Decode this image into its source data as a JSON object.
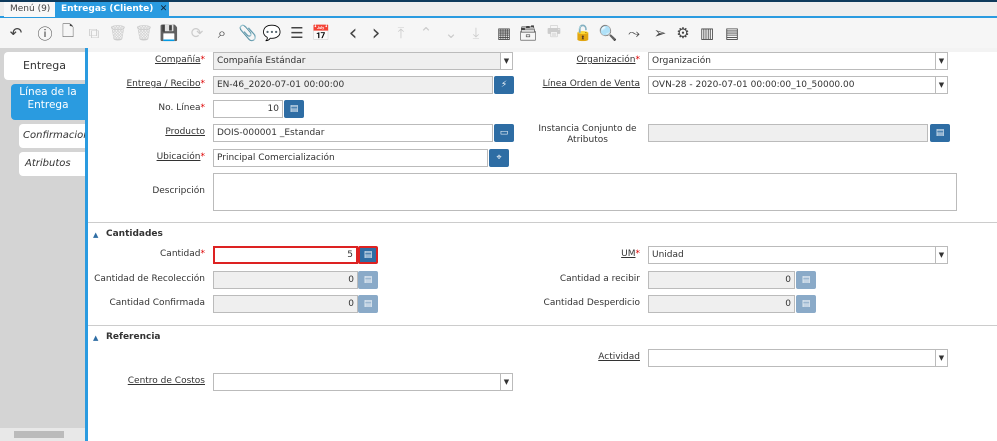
{
  "window_tabs": [
    {
      "label": "Menú (9)"
    },
    {
      "label": "Entregas (Cliente)"
    }
  ],
  "toolbar": [
    "undo-icon",
    "help-icon",
    "new-record-icon",
    "copy-icon",
    "delete-icon",
    "delete-selection-icon",
    "save-icon",
    "refresh-icon",
    "search-icon",
    "attachment-icon",
    "chat-icon",
    "grid-toggle-icon",
    "calendar-icon",
    "previous-icon",
    "next-icon",
    "first-icon",
    "parent-icon",
    "detail-icon",
    "last-icon",
    "report-icon",
    "archive-icon",
    "print-icon",
    "lock-icon",
    "zoom-across-icon",
    "workflow-icon",
    "send-icon",
    "process-icon",
    "barcode-icon",
    "document-icon"
  ],
  "side_tabs": {
    "entrega": "Entrega",
    "linea": "Línea de la Entrega",
    "confirmacion": "Confirmacion",
    "atributos": "Atributos"
  },
  "fields": {
    "compania": {
      "label": "Compañía",
      "value": "Compañía Estándar"
    },
    "organizacion": {
      "label": "Organización",
      "value": "Organización"
    },
    "entrega": {
      "label": "Entrega / Recibo",
      "value": "EN-46_2020-07-01 00:00:00"
    },
    "linea_ov": {
      "label": "Línea Orden de Venta",
      "value": "OVN-28 - 2020-07-01 00:00:00_10_50000.00"
    },
    "no_linea": {
      "label": "No. Línea",
      "value": "10"
    },
    "producto": {
      "label": "Producto",
      "value": "DOIS-000001 _Estandar"
    },
    "instancia": {
      "label": "Instancia Conjunto de Atributos",
      "value": ""
    },
    "ubicacion": {
      "label": "Ubicación",
      "value": "Principal Comercialización"
    },
    "descripcion": {
      "label": "Descripción",
      "value": ""
    }
  },
  "cantidades": {
    "title": "Cantidades",
    "cantidad": {
      "label": "Cantidad",
      "value": "5"
    },
    "um": {
      "label": "UM",
      "value": "Unidad"
    },
    "recoleccion": {
      "label": "Cantidad de Recolección",
      "value": "0"
    },
    "a_recibir": {
      "label": "Cantidad a recibir",
      "value": "0"
    },
    "confirmada": {
      "label": "Cantidad Confirmada",
      "value": "0"
    },
    "desperdicio": {
      "label": "Cantidad Desperdicio",
      "value": "0"
    }
  },
  "referencia": {
    "title": "Referencia",
    "actividad": {
      "label": "Actividad",
      "value": ""
    },
    "centro_costos": {
      "label": "Centro de Costos",
      "value": ""
    }
  },
  "required_mark": "*",
  "colors": {
    "accent": "#2a9be0",
    "button": "#2e6da4",
    "required": "#dd0000"
  }
}
